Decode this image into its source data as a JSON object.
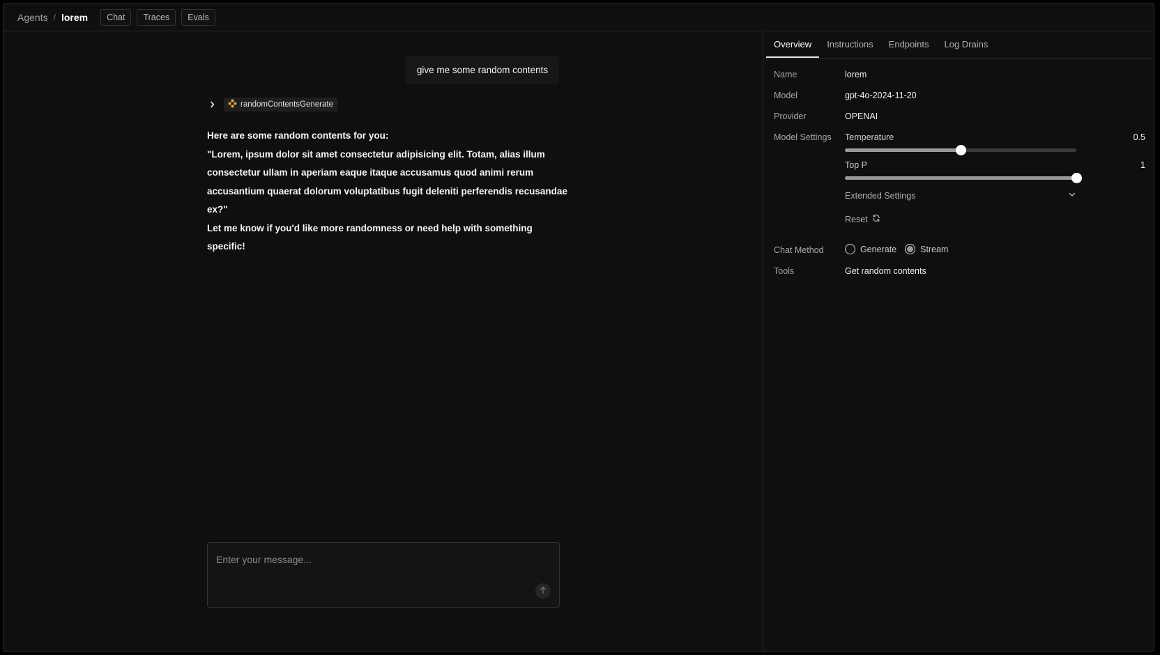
{
  "breadcrumb": {
    "root": "Agents",
    "separator": "/",
    "current": "lorem"
  },
  "top_tabs": [
    {
      "label": "Chat"
    },
    {
      "label": "Traces"
    },
    {
      "label": "Evals"
    }
  ],
  "chat": {
    "user_message": "give me some random contents",
    "tool_call": {
      "name": "randomContentsGenerate",
      "icon": "tool-icon",
      "icon_color": "#e9a03b"
    },
    "assistant_lines": [
      "Here are some random contents for you:",
      "\"Lorem, ipsum dolor sit amet consectetur adipisicing elit. Totam, alias illum consectetur ullam in aperiam eaque itaque accusamus quod animi rerum accusantium quaerat dolorum voluptatibus fugit deleniti perferendis recusandae ex?\"",
      "Let me know if you'd like more randomness or need help with something specific!"
    ],
    "composer": {
      "placeholder": "Enter your message...",
      "send_icon": "arrow-up-icon"
    }
  },
  "side_tabs": [
    {
      "label": "Overview",
      "active": true
    },
    {
      "label": "Instructions",
      "active": false
    },
    {
      "label": "Endpoints",
      "active": false
    },
    {
      "label": "Log Drains",
      "active": false
    }
  ],
  "overview": {
    "name": {
      "label": "Name",
      "value": "lorem"
    },
    "model": {
      "label": "Model",
      "value": "gpt-4o-2024-11-20"
    },
    "provider": {
      "label": "Provider",
      "value": "OPENAI"
    },
    "model_settings": {
      "label": "Model Settings",
      "temperature": {
        "label": "Temperature",
        "value_text": "0.5",
        "fraction": 0.5
      },
      "top_p": {
        "label": "Top P",
        "value_text": "1",
        "fraction": 1.0
      },
      "extended_label": "Extended Settings",
      "reset_label": "Reset"
    },
    "chat_method": {
      "label": "Chat Method",
      "options": [
        {
          "label": "Generate",
          "selected": false
        },
        {
          "label": "Stream",
          "selected": true
        }
      ]
    },
    "tools": {
      "label": "Tools",
      "value": "Get random contents"
    }
  },
  "colors": {
    "background": "#0f0f0f",
    "accent": "#e9a03b",
    "border": "#2a2a2a"
  }
}
